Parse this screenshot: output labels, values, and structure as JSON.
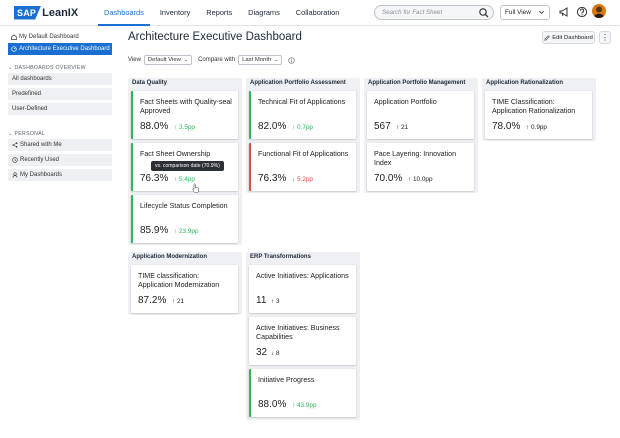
{
  "app": {
    "logo_sap": "SAP",
    "logo_name": "LeanIX"
  },
  "nav": [
    "Dashboards",
    "Inventory",
    "Reports",
    "Diagrams",
    "Collaboration"
  ],
  "search": {
    "placeholder": "Search for Fact Sheet"
  },
  "view_select": {
    "value": "Full View"
  },
  "sidebar": {
    "top_links": [
      "My Default Dashboard",
      "Architecture Executive Dashboard"
    ],
    "overview_title": "DASHBOARDS OVERVIEW",
    "overview_items": [
      "All dashboards",
      "Predefined",
      "User-Defined"
    ],
    "personal_title": "PERSONAL",
    "personal_items": [
      "Shared with Me",
      "Recently Used",
      "My Dashboards"
    ]
  },
  "page": {
    "title": "Architecture Executive Dashboard",
    "edit_label": "Edit Dashboard",
    "more_label": "⋮",
    "view_label": "View",
    "view_value": "Default View",
    "compare_label": "Compare with",
    "compare_value": "Last Month"
  },
  "groups": [
    {
      "title": "Data Quality",
      "cards": [
        {
          "title": "Fact Sheets with Quality-seal Approved",
          "value": "88.0%",
          "delta": "3.5pp",
          "direction": "up"
        },
        {
          "title": "Fact Sheet Ownership",
          "value": "76.3%",
          "delta": "5.4pp",
          "direction": "up"
        },
        {
          "title": "Lifecycle Status Completion",
          "value": "85.9%",
          "delta": "23.9pp",
          "direction": "up"
        }
      ]
    },
    {
      "title": "Application Portfolio Assessment",
      "cards": [
        {
          "title": "Technical Fit of Applications",
          "value": "82.0%",
          "delta": "0.7pp",
          "direction": "up"
        },
        {
          "title": "Functional Fit of Applications",
          "value": "76.3%",
          "delta": "5.2pp",
          "direction": "down"
        }
      ]
    },
    {
      "title": "Application Portfolio Management",
      "cards": [
        {
          "title": "Application Portfolio",
          "value": "567",
          "delta": "21",
          "direction": "neutral"
        },
        {
          "title": "Pace Layering: Innovation Index",
          "value": "70.0%",
          "delta": "10.0pp",
          "direction": "neutral"
        }
      ]
    },
    {
      "title": "Application Rationalization",
      "cards": [
        {
          "title": "TIME Classification: Application Rationalization",
          "value": "78.0%",
          "delta": "0.9pp",
          "direction": "neutral"
        }
      ]
    },
    {
      "title": "Application Modernization",
      "cards": [
        {
          "title": "TIME classification: Application Modernization",
          "value": "87.2%",
          "delta": "21",
          "direction": "neutral"
        }
      ]
    },
    {
      "title": "ERP Transformations",
      "cards": [
        {
          "title": "Active Initiatives: Applications",
          "value": "11",
          "delta": "3",
          "direction": "neutral"
        },
        {
          "title": "Active Initiatives: Business Capabilities",
          "value": "32",
          "delta": "8",
          "direction": "neutral-down"
        },
        {
          "title": "Initiative Progress",
          "value": "88.0%",
          "delta": "43.9pp",
          "direction": "up"
        }
      ]
    }
  ],
  "tooltip": "vs. comparison date (70.9%)",
  "colors": {
    "accent": "#1a6fd1",
    "positive": "#2eb85c",
    "negative": "#e04d4d"
  }
}
